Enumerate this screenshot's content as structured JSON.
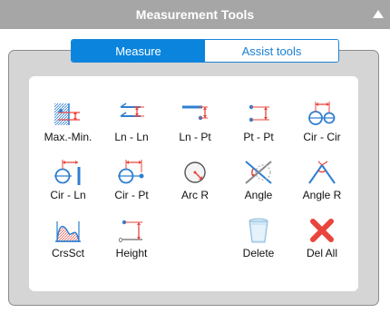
{
  "window": {
    "title": "Measurement Tools"
  },
  "tabs": [
    {
      "label": "Measure",
      "active": true
    },
    {
      "label": "Assist tools",
      "active": false
    }
  ],
  "tools": [
    {
      "label": "Max.-Min.",
      "icon": "max-min-icon"
    },
    {
      "label": "Ln - Ln",
      "icon": "line-line-icon"
    },
    {
      "label": "Ln - Pt",
      "icon": "line-point-icon"
    },
    {
      "label": "Pt - Pt",
      "icon": "point-point-icon"
    },
    {
      "label": "Cir - Cir",
      "icon": "circle-circle-icon"
    },
    {
      "label": "Cir - Ln",
      "icon": "circle-line-icon"
    },
    {
      "label": "Cir - Pt",
      "icon": "circle-point-icon"
    },
    {
      "label": "Arc R",
      "icon": "arc-radius-icon"
    },
    {
      "label": "Angle",
      "icon": "angle-icon"
    },
    {
      "label": "Angle R",
      "icon": "angle-radius-icon"
    },
    {
      "label": "CrsSct",
      "icon": "cross-section-icon"
    },
    {
      "label": "Height",
      "icon": "height-icon",
      "axis_label": "0"
    },
    {
      "label": "Delete",
      "icon": "trash-icon"
    },
    {
      "label": "Del All",
      "icon": "delete-all-icon"
    }
  ],
  "colors": {
    "title_bar": "#a6a6a6",
    "accent": "#0a84dc",
    "measure": "#e8453c",
    "line": "#2f7fd0"
  }
}
